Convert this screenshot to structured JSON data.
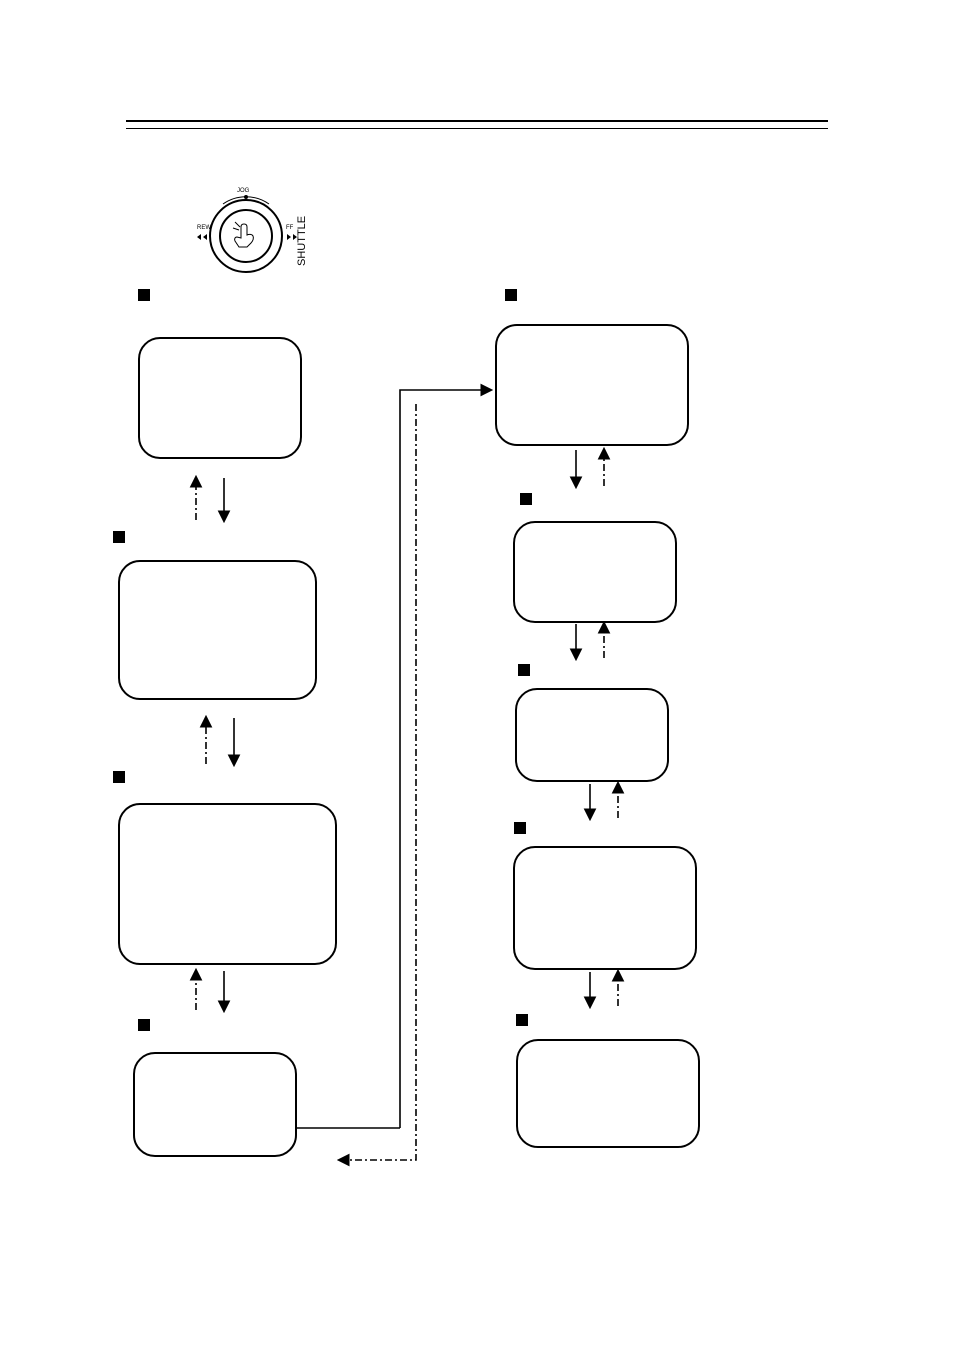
{
  "dial": {
    "left_label": "REW",
    "right_label": "FF",
    "top_label": "JOG",
    "mode_label": "SHUTTLE"
  },
  "left_column": {
    "step1": {
      "bullet": true
    },
    "step2": {
      "bullet": true
    },
    "step3": {
      "bullet": true
    },
    "step4": {
      "bullet": true
    }
  },
  "right_column": {
    "step1": {
      "bullet": true
    },
    "step2": {
      "bullet": true
    },
    "step3": {
      "bullet": true
    },
    "step4": {
      "bullet": true
    },
    "step5": {
      "bullet": true
    }
  }
}
